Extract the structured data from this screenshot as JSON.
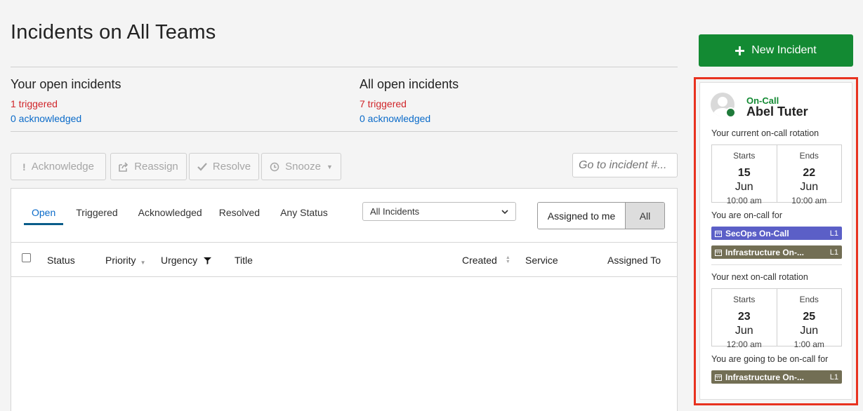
{
  "page": {
    "title": "Incidents on All Teams"
  },
  "summary": {
    "yours": {
      "label": "Your open incidents",
      "triggered": "1 triggered",
      "acknowledged": "0 acknowledged"
    },
    "all": {
      "label": "All open incidents",
      "triggered": "7 triggered",
      "acknowledged": "0 acknowledged"
    }
  },
  "actions": {
    "acknowledge": "Acknowledge",
    "reassign": "Reassign",
    "resolve": "Resolve",
    "snooze": "Snooze"
  },
  "goto": {
    "placeholder": "Go to incident #..."
  },
  "tabs": [
    "Open",
    "Triggered",
    "Acknowledged",
    "Resolved",
    "Any Status"
  ],
  "filter": {
    "selected": "All Incidents"
  },
  "assignment": {
    "me": "Assigned to me",
    "all": "All"
  },
  "table": {
    "columns": [
      "Status",
      "Priority",
      "Urgency",
      "Title",
      "Created",
      "Service",
      "Assigned To"
    ]
  },
  "new_incident": {
    "label": "New Incident"
  },
  "oncall": {
    "label": "On-Call",
    "name": "Abel Tuter",
    "current_heading": "Your current on-call rotation",
    "current": {
      "starts_label": "Starts",
      "start_day": "15",
      "start_month": "Jun",
      "start_time": "10:00 am",
      "ends_label": "Ends",
      "end_day": "22",
      "end_month": "Jun",
      "end_time": "10:00 am"
    },
    "oncall_for_heading": "You are on-call for",
    "oncall_for": [
      {
        "name": "SecOps On-Call",
        "level": "L1",
        "color": "#5b5fc7"
      },
      {
        "name": "Infrastructure On-...",
        "level": "L1",
        "color": "#726e54"
      }
    ],
    "next_heading": "Your next on-call rotation",
    "next": {
      "starts_label": "Starts",
      "start_day": "23",
      "start_month": "Jun",
      "start_time": "12:00 am",
      "ends_label": "Ends",
      "end_day": "25",
      "end_month": "Jun",
      "end_time": "1:00 am"
    },
    "future_heading": "You are going to be on-call for",
    "future_for": [
      {
        "name": "Infrastructure On-...",
        "level": "L1",
        "color": "#726e54"
      }
    ]
  },
  "colors": {
    "accent_green": "#138a33",
    "highlight": "#e8321f",
    "triggered": "#d0262b",
    "link": "#0b6bc9"
  }
}
